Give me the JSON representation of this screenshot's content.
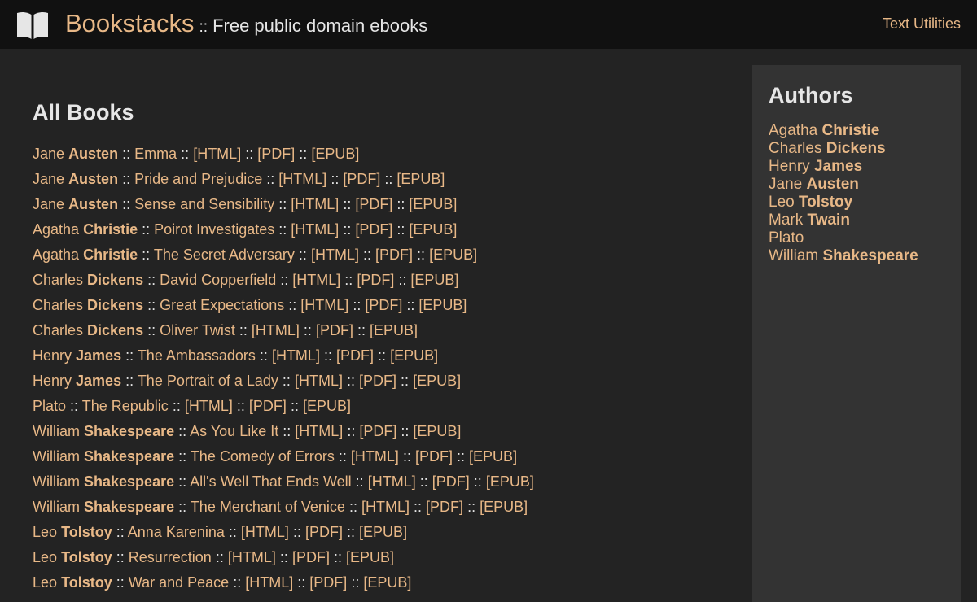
{
  "header": {
    "brand": "Bookstacks",
    "separator": "::",
    "tagline": "Free public domain ebooks",
    "logo_icon": "open-book-icon",
    "utilities_link": "Text Utilities"
  },
  "main": {
    "title": "All Books",
    "separator": "::",
    "format_labels": [
      "[HTML]",
      "[PDF]",
      "[EPUB]"
    ],
    "books": [
      {
        "first": "Jane",
        "last": "Austen",
        "title": "Emma"
      },
      {
        "first": "Jane",
        "last": "Austen",
        "title": "Pride and Prejudice"
      },
      {
        "first": "Jane",
        "last": "Austen",
        "title": "Sense and Sensibility"
      },
      {
        "first": "Agatha",
        "last": "Christie",
        "title": "Poirot Investigates"
      },
      {
        "first": "Agatha",
        "last": "Christie",
        "title": "The Secret Adversary"
      },
      {
        "first": "Charles",
        "last": "Dickens",
        "title": "David Copperfield"
      },
      {
        "first": "Charles",
        "last": "Dickens",
        "title": "Great Expectations"
      },
      {
        "first": "Charles",
        "last": "Dickens",
        "title": "Oliver Twist"
      },
      {
        "first": "Henry",
        "last": "James",
        "title": "The Ambassadors"
      },
      {
        "first": "Henry",
        "last": "James",
        "title": "The Portrait of a Lady"
      },
      {
        "first": "Plato",
        "last": "",
        "title": "The Republic"
      },
      {
        "first": "William",
        "last": "Shakespeare",
        "title": "As You Like It"
      },
      {
        "first": "William",
        "last": "Shakespeare",
        "title": "The Comedy of Errors"
      },
      {
        "first": "William",
        "last": "Shakespeare",
        "title": "All's Well That Ends Well"
      },
      {
        "first": "William",
        "last": "Shakespeare",
        "title": "The Merchant of Venice"
      },
      {
        "first": "Leo",
        "last": "Tolstoy",
        "title": "Anna Karenina"
      },
      {
        "first": "Leo",
        "last": "Tolstoy",
        "title": "Resurrection"
      },
      {
        "first": "Leo",
        "last": "Tolstoy",
        "title": "War and Peace"
      }
    ]
  },
  "sidebar": {
    "title": "Authors",
    "authors": [
      {
        "first": "Agatha",
        "last": "Christie"
      },
      {
        "first": "Charles",
        "last": "Dickens"
      },
      {
        "first": "Henry",
        "last": "James"
      },
      {
        "first": "Jane",
        "last": "Austen"
      },
      {
        "first": "Leo",
        "last": "Tolstoy"
      },
      {
        "first": "Mark",
        "last": "Twain"
      },
      {
        "first": "Plato",
        "last": ""
      },
      {
        "first": "William",
        "last": "Shakespeare"
      }
    ]
  },
  "colors": {
    "header_bg": "#111111",
    "page_bg": "#232323",
    "sidebar_bg": "#333333",
    "link": "#e8b887",
    "text": "#e6e6e6"
  }
}
